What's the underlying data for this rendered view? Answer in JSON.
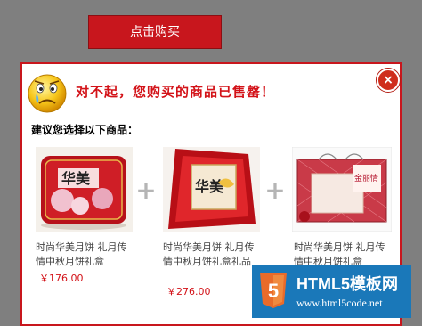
{
  "buy_button": {
    "label": "点击购买"
  },
  "modal": {
    "close_label": "×",
    "sold_out_message": "对不起，您购买的商品已售罄！",
    "suggest_label": "建议您选择以下商品：",
    "plus_sign": "+",
    "products": [
      {
        "name": "时尚华美月饼 礼月传情中秋月饼礼盒",
        "price": "￥176.00",
        "box_color": "#c8161d"
      },
      {
        "name": "时尚华美月饼 礼月传情中秋月饼礼盒礼品",
        "price": "￥276.00",
        "box_color": "#d31b1b"
      },
      {
        "name": "时尚华美月饼 礼月传情中秋月饼礼盒",
        "price": "",
        "box_color": "#d44b5a"
      }
    ]
  },
  "watermark": {
    "title": "HTML5模板网",
    "url": "www.html5code.net"
  },
  "colors": {
    "accent": "#c8161d",
    "backdrop": "#7f7f7f",
    "watermark_bg": "#1a78b9"
  }
}
